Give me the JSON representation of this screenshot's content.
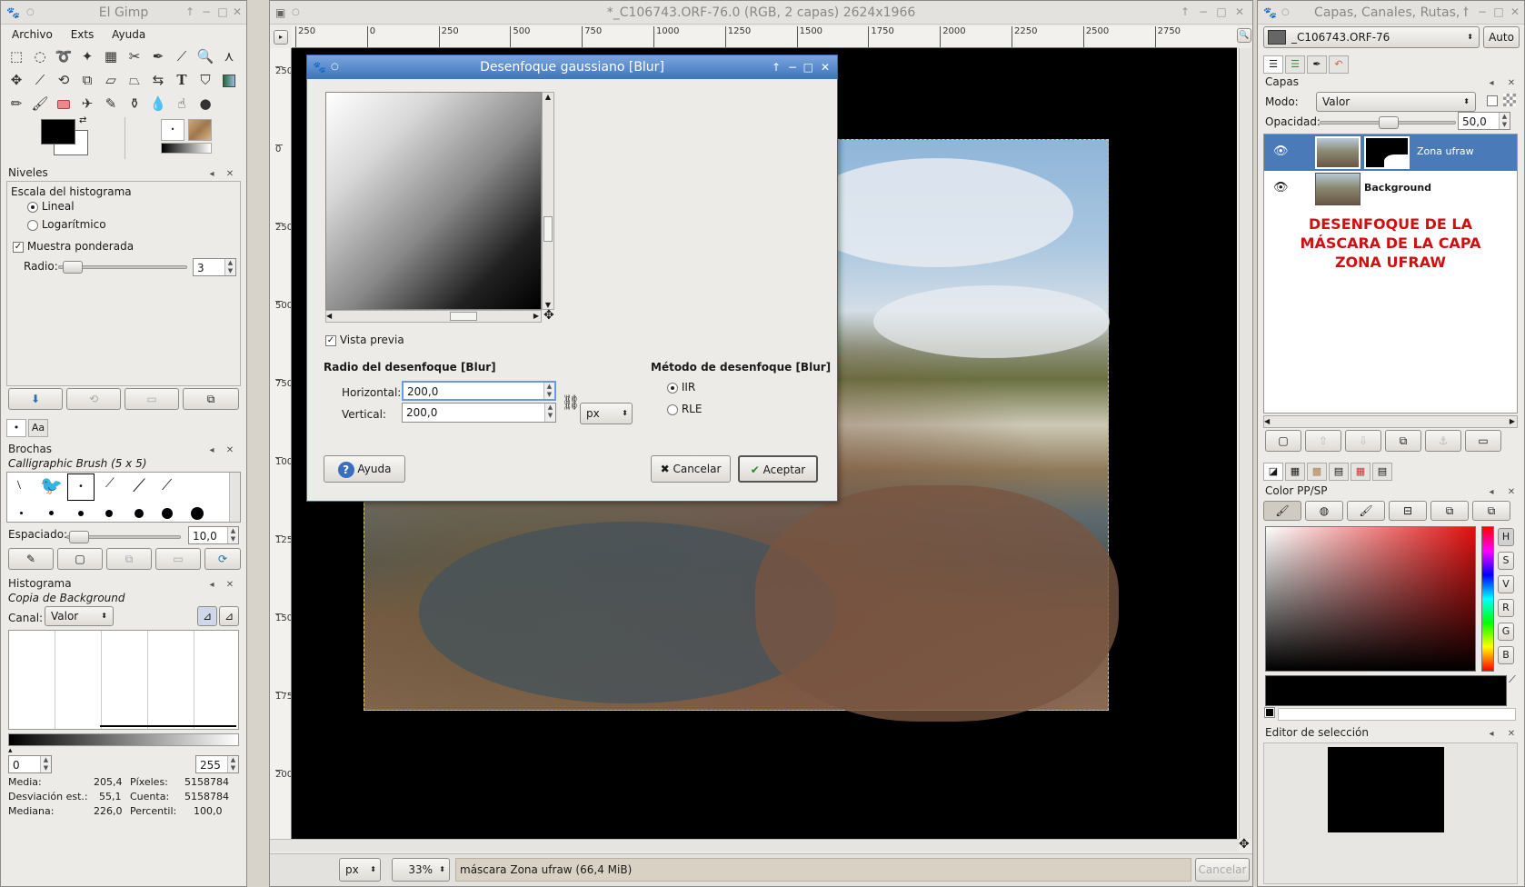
{
  "toolbox": {
    "title": "El Gimp",
    "menu": [
      "Archivo",
      "Exts",
      "Ayuda"
    ],
    "levels": {
      "title": "Niveles",
      "scale_label": "Escala del histograma",
      "linear": "Lineal",
      "log": "Logarítmico",
      "weighted": "Muestra ponderada",
      "radius_label": "Radio:",
      "radius_value": "3"
    },
    "brushes": {
      "title": "Brochas",
      "brush_name": "Calligraphic Brush (5 x 5)",
      "spacing_label": "Espaciado:",
      "spacing_value": "10,0"
    },
    "histogram": {
      "title": "Histograma",
      "layer": "Copia de Background",
      "channel_label": "Canal:",
      "channel_value": "Valor",
      "min": "0",
      "max": "255",
      "stats": {
        "mean_label": "Media:",
        "mean": "205,4",
        "pixels_label": "Píxeles:",
        "pixels": "5158784",
        "std_label": "Desviación est.:",
        "std": "55,1",
        "count_label": "Cuenta:",
        "count": "5158784",
        "median_label": "Mediana:",
        "median": "226,0",
        "percentile_label": "Percentil:",
        "percentile": "100,0"
      }
    }
  },
  "image_window": {
    "title": "*_C106743.ORF-76.0 (RGB, 2 capas) 2624x1966",
    "ruler_h": [
      "250",
      "0",
      "250",
      "500",
      "750",
      "1000",
      "1250",
      "1500",
      "1750",
      "2000",
      "2250",
      "2500",
      "2750"
    ],
    "ruler_v": [
      "250",
      "0",
      "250",
      "500",
      "750",
      "1000",
      "1250",
      "1500",
      "1750",
      "2000"
    ],
    "unit": "px",
    "zoom": "33%",
    "status": "máscara Zona ufraw  (66,4 MiB)",
    "cancel": "Cancelar"
  },
  "blur_dialog": {
    "title": "Desenfoque gaussiano [Blur]",
    "preview_label": "Vista previa",
    "radius_title": "Radio del desenfoque [Blur]",
    "horizontal_label": "Horizontal:",
    "horizontal_value": "200,0",
    "vertical_label": "Vertical:",
    "vertical_value": "200,0",
    "unit": "px",
    "method_title": "Método de desenfoque [Blur]",
    "method_iir": "IIR",
    "method_rle": "RLE",
    "help": "Ayuda",
    "cancel": "Cancelar",
    "ok": "Aceptar"
  },
  "layers_window": {
    "title": "Capas, Canales, Rutas, I",
    "image_select": "_C106743.ORF-76",
    "auto": "Auto",
    "section": "Capas",
    "mode_label": "Modo:",
    "mode_value": "Valor",
    "opacity_label": "Opacidad:",
    "opacity_value": "50,0",
    "opacity_fraction": 0.5,
    "layers": [
      {
        "name": "Zona ufraw",
        "selected": true
      },
      {
        "name": "Background",
        "selected": false
      }
    ],
    "annotation_lines": [
      "DESENFOQUE DE LA",
      "MÁSCARA DE LA CAPA",
      "ZONA UFRAW"
    ],
    "color_title": "Color PP/SP",
    "color_channels": [
      "H",
      "S",
      "V",
      "R",
      "G",
      "B"
    ],
    "selection_editor": "Editor de selección"
  },
  "colors": {
    "accent": "#4a7ab8",
    "annotation": "#d01010",
    "canvas_bg": "#000000"
  }
}
